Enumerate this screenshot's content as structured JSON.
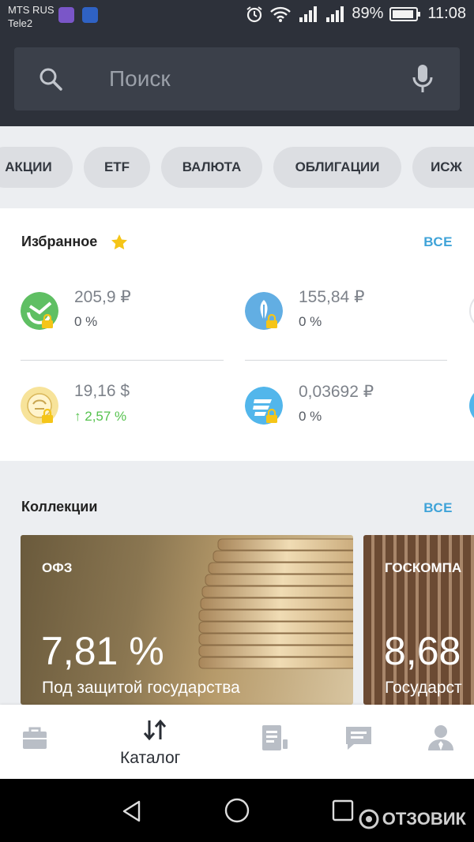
{
  "status_bar": {
    "carrier1": "MTS RUS",
    "carrier2": "Tele2",
    "battery_percent": "89%",
    "time": "11:08"
  },
  "search": {
    "placeholder": "Поиск"
  },
  "categories": [
    "АКЦИИ",
    "ETF",
    "ВАЛЮТА",
    "ОБЛИГАЦИИ",
    "ИСЖ"
  ],
  "favorites": {
    "title": "Избранное",
    "all_label": "ВСЕ",
    "items": [
      {
        "price": "205,9 ₽",
        "change": "0 %",
        "icon": "sberbank-logo-icon",
        "locked": true
      },
      {
        "price": "155,84 ₽",
        "change": "0 %",
        "icon": "gazprom-logo-icon",
        "locked": true
      },
      {
        "price": "19,16 $",
        "change": "2,57 %",
        "direction": "up",
        "icon": "moscow-exchange-logo-icon",
        "locked": true
      },
      {
        "price": "0,03692 ₽",
        "change": "0 %",
        "icon": "vtb-logo-icon",
        "locked": true
      }
    ]
  },
  "collections": {
    "title": "Коллекции",
    "all_label": "ВСЕ",
    "items": [
      {
        "label": "ОФЗ",
        "rate": "7,81 %",
        "subtitle": "Под защитой государства"
      },
      {
        "label": "ГОСКОМПА",
        "rate": "8,68",
        "subtitle": "Государст"
      }
    ]
  },
  "bottom_nav": {
    "items": [
      {
        "icon": "briefcase-icon"
      },
      {
        "icon": "sort-arrows-icon",
        "label": "Каталог",
        "active": true
      },
      {
        "icon": "document-icon"
      },
      {
        "icon": "chat-icon"
      },
      {
        "icon": "profile-icon"
      }
    ]
  },
  "watermark": "ОТЗОВИК",
  "colors": {
    "accent": "#3fa3d8",
    "positive": "#55c24d",
    "header": "#2d313a",
    "star": "#f5c518"
  }
}
